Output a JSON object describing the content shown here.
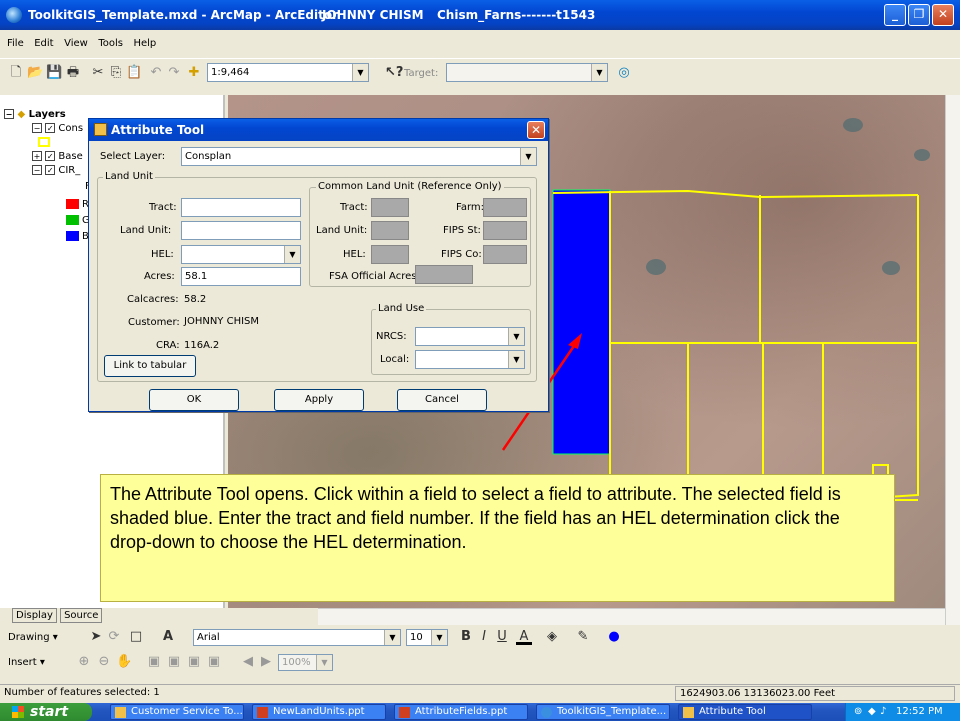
{
  "window": {
    "title": "ToolkitGIS_Template.mxd - ArcMap - ArcEditor",
    "user": "JOHNNY CHISM",
    "farm": "Chism_Farns-------t1543"
  },
  "menu": [
    "File",
    "Edit",
    "View",
    "Tools",
    "Help"
  ],
  "toolbar": {
    "scale": "1:9,464",
    "target_label": "Target:",
    "target_value": ""
  },
  "toc": {
    "root": "Layers",
    "items": [
      {
        "label": "Cons"
      },
      {
        "label": "Base"
      },
      {
        "label": "CIR_"
      }
    ],
    "legend": [
      {
        "label": "R",
        "color": "#ff0000"
      },
      {
        "label": "G",
        "color": "#00c000"
      },
      {
        "label": "B",
        "color": "#0000ff"
      }
    ],
    "subs": "F",
    "tabs": [
      "Display",
      "Source"
    ]
  },
  "dialog": {
    "title": "Attribute Tool",
    "select_layer_label": "Select Layer:",
    "select_layer_value": "Consplan",
    "land_unit": {
      "group": "Land Unit",
      "tract_label": "Tract:",
      "tract_value": "",
      "land_unit_label": "Land Unit:",
      "land_unit_value": "",
      "hel_label": "HEL:",
      "hel_value": "",
      "acres_label": "Acres:",
      "acres_value": "58.1",
      "calcacres_label": "Calcacres:",
      "calcacres_value": "58.2",
      "customer_label": "Customer:",
      "customer_value": "JOHNNY CHISM",
      "cra_label": "CRA:",
      "cra_value": "116A.2",
      "link_button": "Link to tabular"
    },
    "clu": {
      "group": "Common Land Unit (Reference Only)",
      "tract_label": "Tract:",
      "farm_label": "Farm:",
      "land_unit_label": "Land Unit:",
      "fips_st_label": "FIPS St:",
      "hel_label": "HEL:",
      "fips_co_label": "FIPS Co:",
      "fsa_acres_label": "FSA Official Acres:"
    },
    "land_use": {
      "group": "Land Use",
      "nrcs_label": "NRCS:",
      "nrcs_value": "",
      "local_label": "Local:",
      "local_value": ""
    },
    "buttons": {
      "ok": "OK",
      "apply": "Apply",
      "cancel": "Cancel"
    }
  },
  "callout": {
    "text": "The Attribute Tool opens. Click within a field to select a field to attribute. The selected field is shaded blue. Enter the tract and field number. If the field has an HEL determination click the drop-down to choose the HEL determination."
  },
  "draw_toolbar": {
    "drawing_label": "Drawing",
    "font": "Arial",
    "size": "10"
  },
  "insert_toolbar": {
    "insert_label": "Insert",
    "zoom": "100%"
  },
  "status": {
    "features": "Number of features selected: 1",
    "coords": "1624903.06  13136023.00 Feet"
  },
  "taskbar": {
    "start": "start",
    "tasks": [
      {
        "label": "Customer Service To..."
      },
      {
        "label": "NewLandUnits.ppt"
      },
      {
        "label": "AttributeFields.ppt"
      },
      {
        "label": "ToolkitGIS_Template..."
      },
      {
        "label": "Attribute Tool"
      }
    ],
    "time": "12:52 PM"
  },
  "colors": {
    "selected_field": "#0000ff",
    "field_boundary": "#ffff00",
    "callout_bg": "#ffff99",
    "arrow": "#ff0000"
  }
}
